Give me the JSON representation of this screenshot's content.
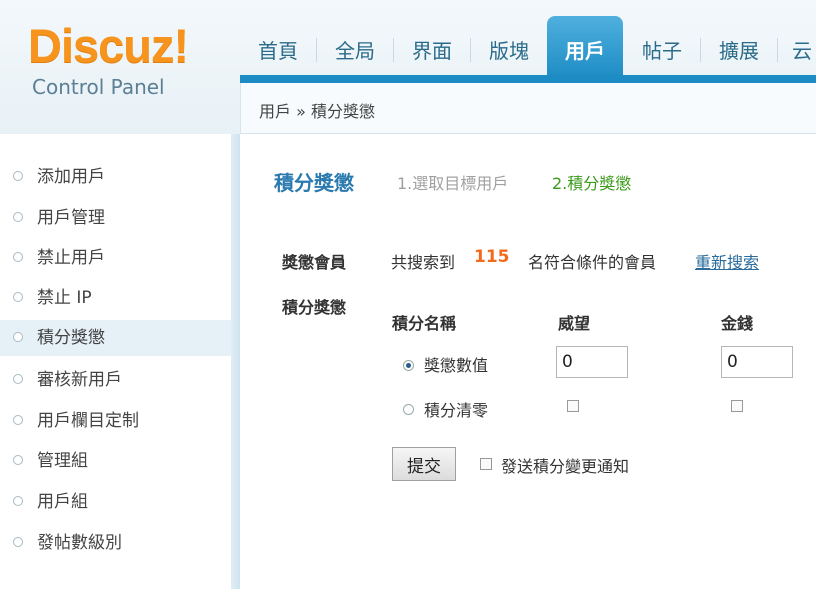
{
  "logo": {
    "brand": "Discuz!",
    "subtitle": "Control Panel"
  },
  "nav": {
    "items": [
      {
        "label": "首頁",
        "active": false
      },
      {
        "label": "全局",
        "active": false
      },
      {
        "label": "界面",
        "active": false
      },
      {
        "label": "版塊",
        "active": false
      },
      {
        "label": "用戶",
        "active": true
      },
      {
        "label": "帖子",
        "active": false
      },
      {
        "label": "擴展",
        "active": false
      },
      {
        "label": "云",
        "active": false
      }
    ]
  },
  "breadcrumb": "用戶 » 積分獎懲",
  "sidebar": {
    "items": [
      {
        "label": "添加用戶"
      },
      {
        "label": "用戶管理"
      },
      {
        "label": "禁止用戶"
      },
      {
        "label": "禁止 IP"
      },
      {
        "label": "積分獎懲",
        "active": true
      },
      {
        "label": "審核新用戶"
      },
      {
        "label": "用戶欄目定制"
      },
      {
        "label": "管理組"
      },
      {
        "label": "用戶組"
      },
      {
        "label": "發帖數級別"
      }
    ]
  },
  "main": {
    "title": "積分獎懲",
    "step1": "1.選取目標用戶",
    "step2": "2.積分獎懲",
    "member_label": "獎懲會員",
    "found_prefix": "共搜索到",
    "found_count": "115",
    "found_suffix": "名符合條件的會員",
    "research_link": "重新搜索",
    "reward_label": "積分獎懲",
    "table": {
      "col_name": "積分名稱",
      "col_1": "威望",
      "col_2": "金錢",
      "row_value_label": "獎懲數值",
      "row_clear_label": "積分清零",
      "value_1": "0",
      "value_2": "0"
    },
    "submit_label": "提交",
    "notify_label": "發送積分變更通知"
  }
}
